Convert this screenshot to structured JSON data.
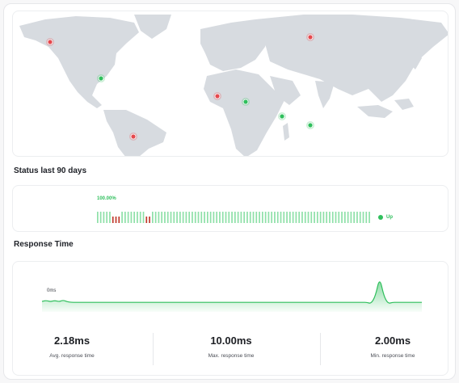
{
  "map": {
    "locations": [
      {
        "name": "alaska",
        "status": "down"
      },
      {
        "name": "russia",
        "status": "down"
      },
      {
        "name": "usa-east",
        "status": "up"
      },
      {
        "name": "west-africa",
        "status": "down"
      },
      {
        "name": "egypt",
        "status": "up"
      },
      {
        "name": "east-africa",
        "status": "up"
      },
      {
        "name": "indian-ocean",
        "status": "up"
      },
      {
        "name": "brazil",
        "status": "down"
      }
    ],
    "colors": {
      "up": "#2fbf5c",
      "down": "#e5484d",
      "land": "#d7dbe0"
    }
  },
  "status": {
    "title": "Status last 90 days",
    "uptime_label": "100.00%",
    "legend_label": "Up",
    "day_count": 90,
    "down_day_indices": [
      5,
      6,
      7,
      16,
      17
    ],
    "colors": {
      "up": "#8ee0a8",
      "down": "#c0392b"
    }
  },
  "response": {
    "title": "Response Time",
    "y_label": "0ms",
    "avg_value": "2.18ms",
    "avg_label": "Avg. response time",
    "max_value": "10.00ms",
    "max_label": "Max. response time",
    "min_value": "2.00ms",
    "min_label": "Min. response time"
  },
  "chart_data": {
    "type": "area",
    "title": "Response Time",
    "ylabel": "",
    "y_tick_labels": [
      "0ms"
    ],
    "series": [
      {
        "values": [
          2.3,
          2.6,
          2.2,
          2.6,
          2.2,
          2.7,
          2.2,
          2.0,
          2.0,
          2.0,
          2.0,
          2.0,
          2.0,
          2.0,
          2.0,
          2.0,
          2.0,
          2.0,
          2.0,
          2.0,
          2.0,
          2.0,
          2.0,
          2.0,
          2.0,
          2.0,
          2.0,
          2.0,
          2.0,
          2.0,
          2.0,
          2.0,
          2.0,
          2.0,
          2.0,
          2.0,
          2.0,
          2.0,
          2.0,
          2.0,
          2.0,
          2.0,
          2.0,
          2.0,
          2.0,
          2.0,
          2.0,
          2.0,
          2.0,
          2.0,
          2.0,
          2.0,
          2.0,
          2.0,
          2.0,
          2.0,
          2.0,
          2.0,
          2.0,
          2.0,
          2.0,
          2.0,
          2.0,
          2.0,
          2.0,
          2.0,
          2.0,
          2.0,
          2.0,
          2.0,
          2.0,
          2.0,
          2.0,
          2.0,
          2.0,
          2.0,
          2.0,
          2.0,
          1.6,
          4.0,
          10.0,
          4.0,
          1.6,
          2.0,
          2.0,
          2.0,
          2.0,
          2.0,
          2.0,
          2.0,
          2.0
        ]
      }
    ],
    "line_color": "#2fbf5c",
    "grid": false
  }
}
